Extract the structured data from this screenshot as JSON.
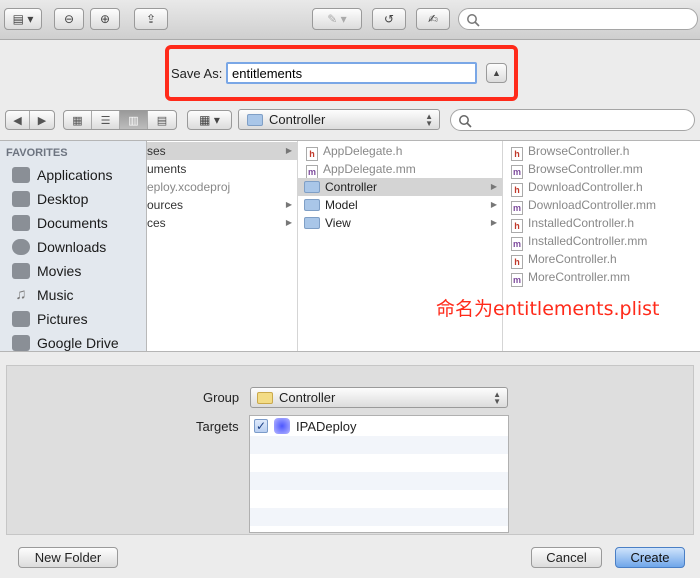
{
  "save_as": {
    "label": "Save As:",
    "value": "entitlements"
  },
  "nav": {
    "back": "◀",
    "forward": "▶",
    "path_folder": "Controller",
    "view_mode": "column"
  },
  "sidebar": {
    "header": "FAVORITES",
    "items": [
      {
        "label": "Applications",
        "icon": "applications-icon"
      },
      {
        "label": "Desktop",
        "icon": "desktop-icon"
      },
      {
        "label": "Documents",
        "icon": "documents-icon"
      },
      {
        "label": "Downloads",
        "icon": "downloads-icon"
      },
      {
        "label": "Movies",
        "icon": "movies-icon"
      },
      {
        "label": "Music",
        "icon": "music-icon"
      },
      {
        "label": "Pictures",
        "icon": "pictures-icon"
      },
      {
        "label": "Google Drive",
        "icon": "google-drive-icon"
      }
    ]
  },
  "col1": [
    "ses",
    "uments",
    "eploy.xcodeproj",
    "ources",
    "ces"
  ],
  "col2": [
    {
      "label": "AppDelegate.h",
      "type": "h"
    },
    {
      "label": "AppDelegate.mm",
      "type": "m"
    },
    {
      "label": "Controller",
      "type": "folder"
    },
    {
      "label": "Model",
      "type": "folder"
    },
    {
      "label": "View",
      "type": "folder"
    }
  ],
  "col3": [
    {
      "label": "BrowseController.h",
      "type": "h"
    },
    {
      "label": "BrowseController.mm",
      "type": "m"
    },
    {
      "label": "DownloadController.h",
      "type": "h"
    },
    {
      "label": "DownloadController.mm",
      "type": "m"
    },
    {
      "label": "InstalledController.h",
      "type": "h"
    },
    {
      "label": "InstalledController.mm",
      "type": "m"
    },
    {
      "label": "MoreController.h",
      "type": "h"
    },
    {
      "label": "MoreController.mm",
      "type": "m"
    }
  ],
  "annotation": "命名为entitlements.plist",
  "group": {
    "label": "Group",
    "value": "Controller"
  },
  "targets": {
    "label": "Targets",
    "items": [
      {
        "label": "IPADeploy",
        "checked": true
      }
    ]
  },
  "buttons": {
    "new_folder": "New Folder",
    "cancel": "Cancel",
    "create": "Create"
  },
  "colors": {
    "accent": "#3a7fd9",
    "highlight_box": "#ff2a1a",
    "annotation": "#ff2a1a"
  }
}
